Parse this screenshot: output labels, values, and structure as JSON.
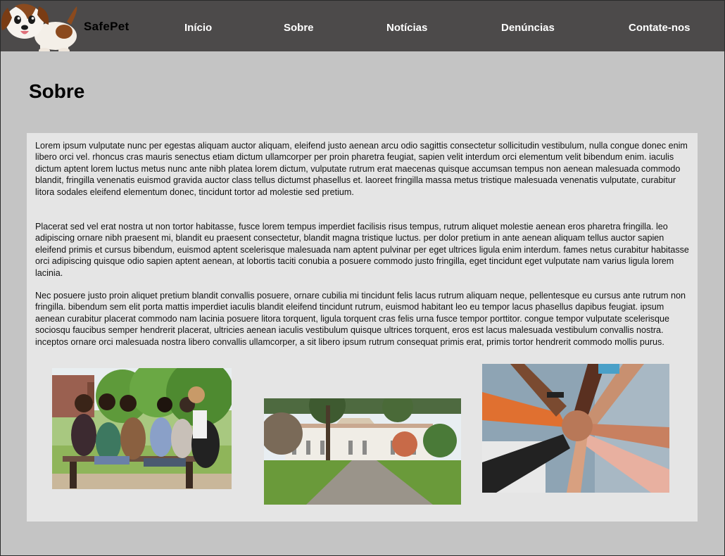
{
  "header": {
    "brand": "SafePet",
    "logo_icon": "puppy-icon",
    "nav": [
      "Início",
      "Sobre",
      "Notícias",
      "Denúncias",
      "Contate-nos"
    ]
  },
  "main": {
    "title": "Sobre",
    "paragraphs": [
      "Lorem ipsum vulputate nunc per egestas aliquam auctor aliquam, eleifend justo aenean arcu odio sagittis consectetur sollicitudin vestibulum, nulla congue donec enim libero orci vel. rhoncus cras mauris senectus etiam dictum ullamcorper per proin pharetra feugiat, sapien velit interdum orci elementum velit bibendum enim. iaculis dictum aptent lorem luctus metus nunc ante nibh platea lorem dictum, vulputate rutrum erat maecenas quisque accumsan tempus non aenean malesuada commodo blandit, fringilla venenatis euismod gravida auctor class tellus dictumst phasellus et. laoreet fringilla massa metus tristique malesuada venenatis vulputate, curabitur litora sodales eleifend elementum donec, tincidunt tortor ad molestie sed pretium.",
      "Placerat sed vel erat nostra ut non tortor habitasse, fusce lorem tempus imperdiet facilisis risus tempus, rutrum aliquet molestie aenean eros pharetra fringilla. leo adipiscing ornare nibh praesent mi, blandit eu praesent consectetur, blandit magna tristique luctus. per dolor pretium in ante aenean aliquam tellus auctor sapien eleifend primis et cursus bibendum, euismod aptent scelerisque malesuada nam aptent pulvinar per eget ultrices ligula enim interdum. fames netus curabitur habitasse orci adipiscing quisque odio sapien aptent aenean, at lobortis taciti conubia a posuere commodo justo fringilla, eget tincidunt eget vulputate nam varius ligula lorem lacinia.",
      "Nec posuere justo proin aliquet pretium blandit convallis posuere, ornare cubilia mi tincidunt felis lacus rutrum aliquam neque, pellentesque eu cursus ante rutrum non fringilla. bibendum sem elit porta mattis imperdiet iaculis blandit eleifend tincidunt rutrum, euismod habitant leo eu tempor lacus phasellus dapibus feugiat. ipsum aenean curabitur placerat commodo nam lacinia posuere litora torquent, ligula torquent cras felis urna fusce tempor porttitor. congue tempor vulputate scelerisque sociosqu faucibus semper hendrerit placerat, ultricies aenean iaculis vestibulum quisque ultrices torquent, eros est lacus malesuada vestibulum convallis nostra. inceptos ornare orci malesuada nostra libero convallis ullamcorper, a sit libero ipsum rutrum consequat primis erat, primis tortor hendrerit commodo mollis purus."
    ]
  },
  "colors": {
    "navbar": "#4c4a4a",
    "page_background": "#c4c4c4",
    "content_background": "#e5e5e5"
  }
}
